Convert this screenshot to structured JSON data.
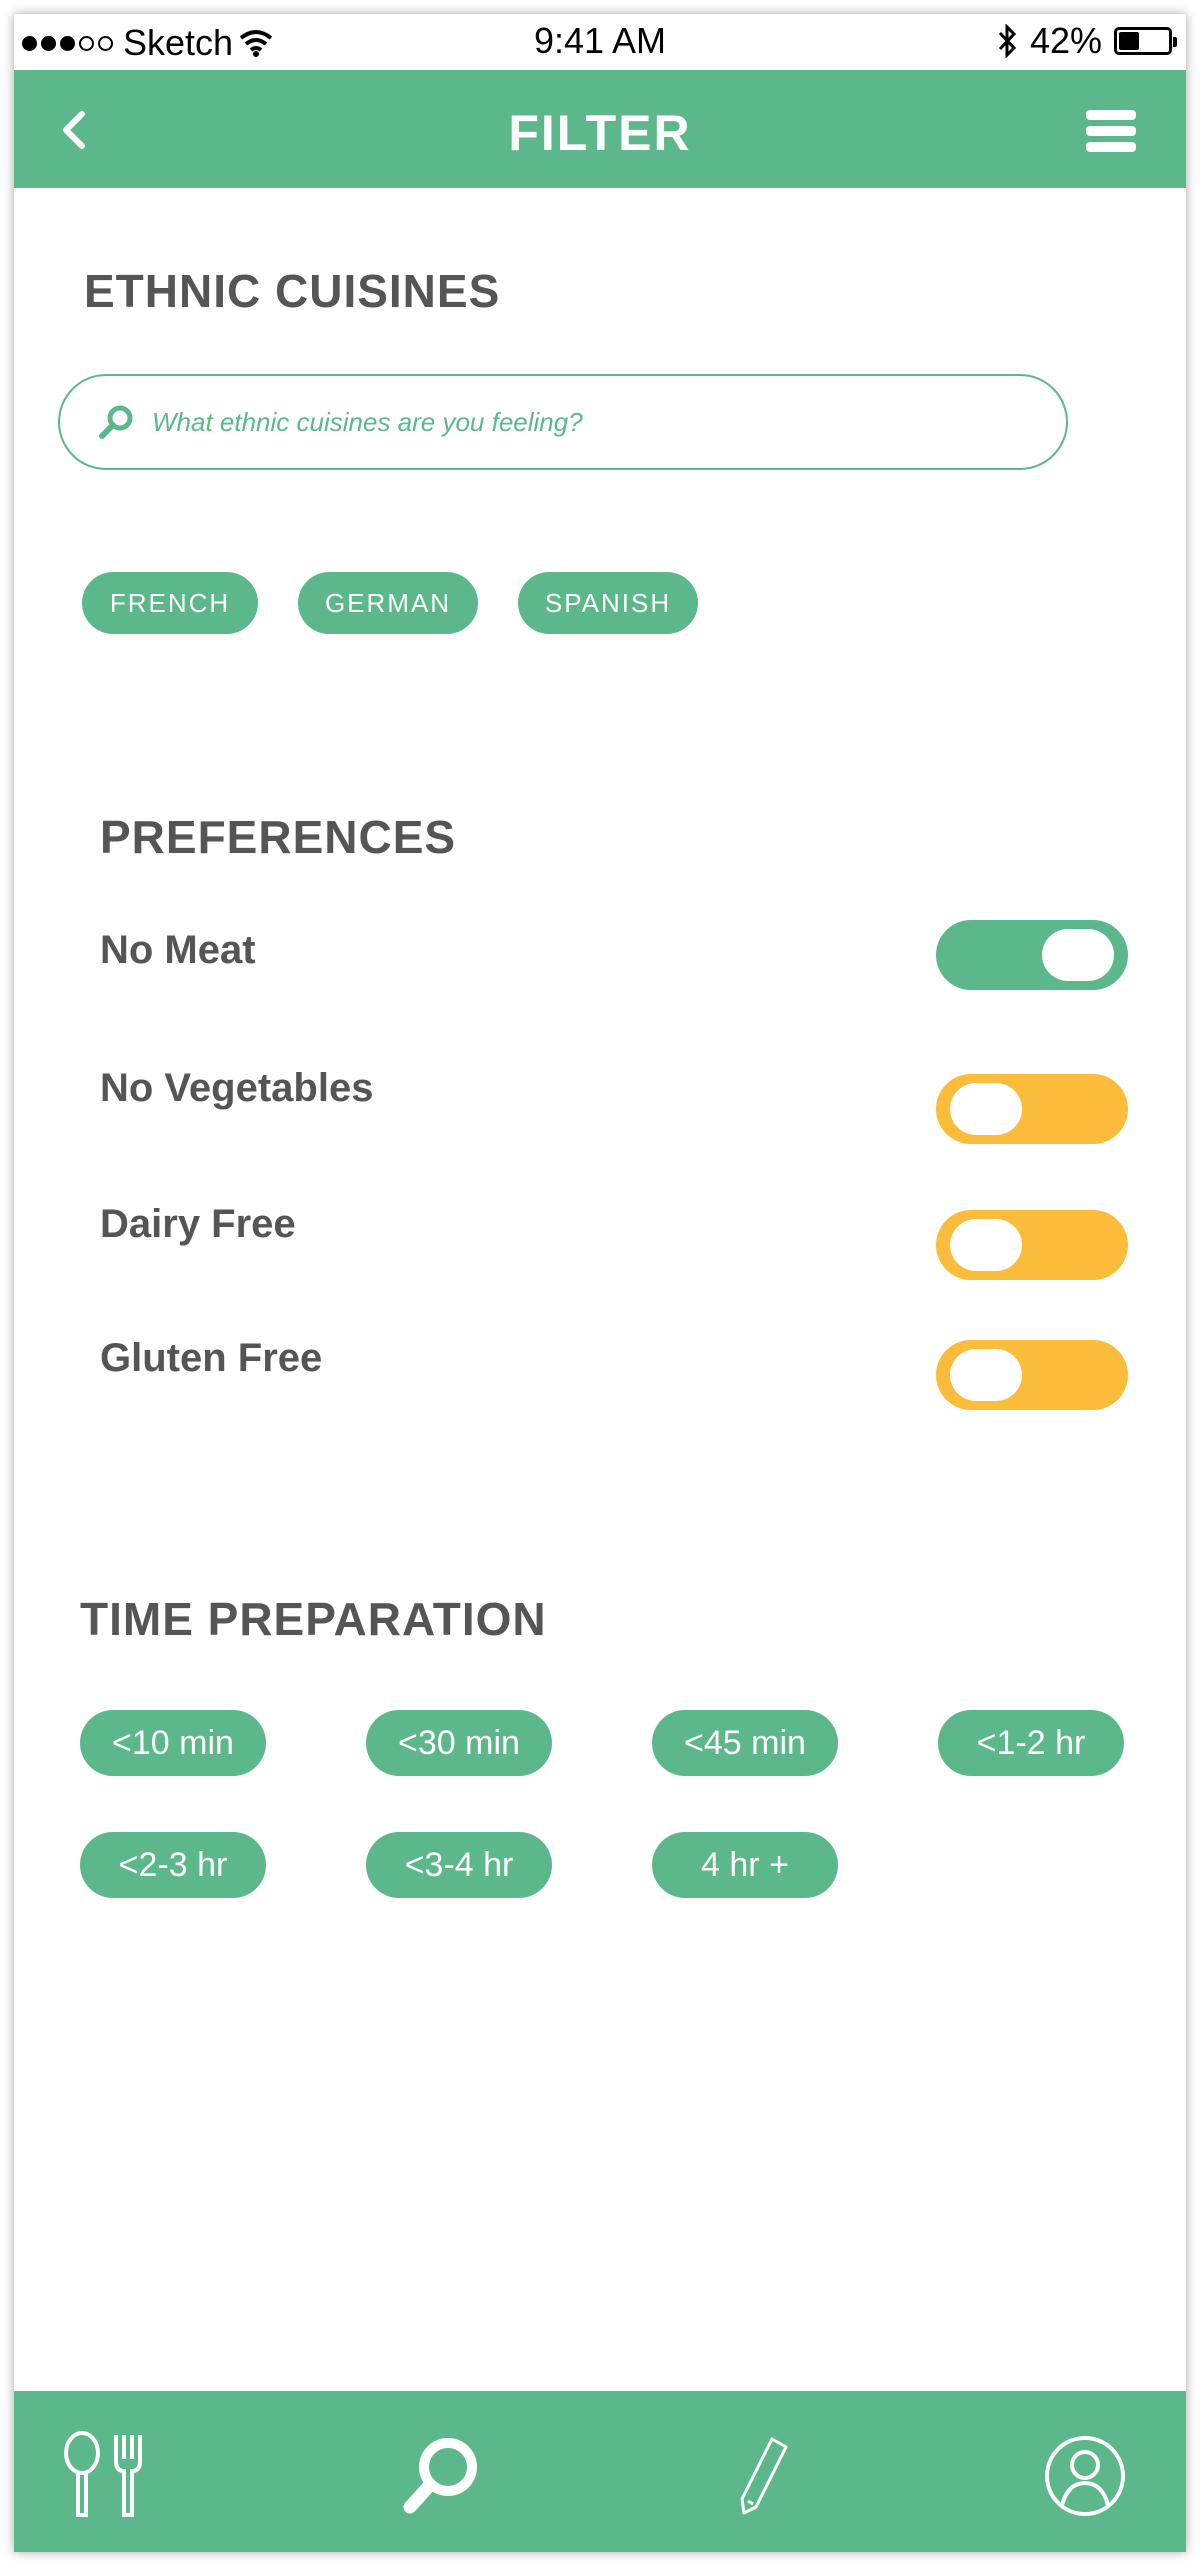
{
  "status_bar": {
    "carrier": "Sketch",
    "time": "9:41 AM",
    "battery": "42%",
    "battery_level": 0.42
  },
  "header": {
    "title": "FILTER",
    "back_icon": "chevron-left-icon",
    "menu_icon": "hamburger-menu-icon"
  },
  "ethnic": {
    "title": "ETHNIC CUISINES",
    "search_placeholder": "What ethnic cuisines are you feeling?",
    "chips": [
      "FRENCH",
      "GERMAN",
      "SPANISH"
    ]
  },
  "preferences": {
    "title": "PREFERENCES",
    "items": [
      {
        "label": "No Meat",
        "on": true
      },
      {
        "label": "No Vegetables",
        "on": false
      },
      {
        "label": "Dairy Free",
        "on": false
      },
      {
        "label": "Gluten Free",
        "on": false
      }
    ]
  },
  "time_prep": {
    "title": "TIME PREPARATION",
    "options": [
      "<10 min",
      "<30 min",
      "<45 min",
      "<1-2 hr",
      "<2-3 hr",
      "<3-4 hr",
      "4 hr +"
    ]
  },
  "colors": {
    "accent": "#5cb88b",
    "toggle_off": "#fbbb3b",
    "text": "#555555"
  },
  "tabbar": {
    "icons": [
      "fork-spoon-icon",
      "search-icon",
      "pencil-icon",
      "profile-icon"
    ]
  }
}
